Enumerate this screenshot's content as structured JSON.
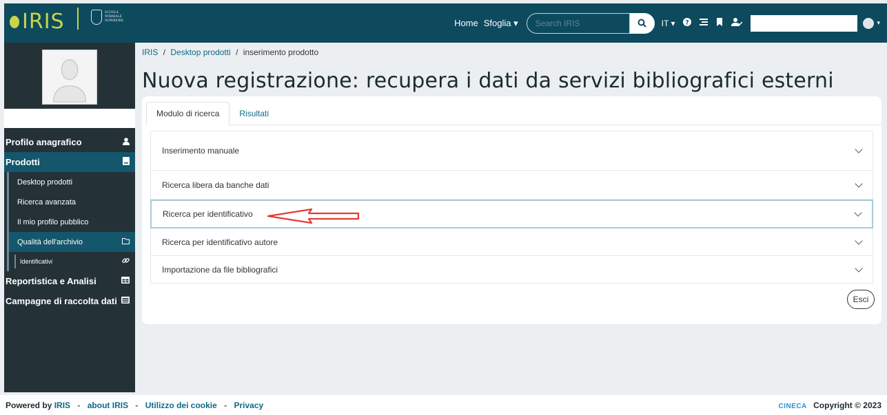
{
  "header": {
    "logo_text": "IRIS",
    "institution_text": "SCUOLA NORMALE SUPERIORE",
    "nav": {
      "home": "Home",
      "browse": "Sfoglia ▾"
    },
    "search": {
      "placeholder": "Search IRIS"
    },
    "language": "IT ▾",
    "icons": [
      "help-icon",
      "list-icon",
      "bookmark-icon",
      "user-badge-icon",
      "user-avatar-icon"
    ]
  },
  "sidebar": {
    "items": [
      {
        "label": "Profilo anagrafico",
        "icon": "user-icon"
      },
      {
        "label": "Prodotti",
        "icon": "book-icon"
      },
      {
        "label": "Desktop prodotti"
      },
      {
        "label": "Ricerca avanzata"
      },
      {
        "label": "Il mio profilo pubblico"
      },
      {
        "label": "Qualità dell'archivio",
        "icon": "folder-icon"
      },
      {
        "label": "Identificativi",
        "icon": "link-icon"
      },
      {
        "label": "Reportistica e Analisi",
        "icon": "table-icon"
      },
      {
        "label": "Campagne di raccolta dati",
        "icon": "list-icon"
      }
    ]
  },
  "breadcrumb": {
    "home": "IRIS",
    "sep": "/",
    "parent": "Desktop prodotti",
    "current": "inserimento prodotto"
  },
  "page_title": "Nuova registrazione: recupera i dati da servizi bibliografici esterni",
  "tabs": [
    {
      "label": "Modulo di ricerca",
      "active": true
    },
    {
      "label": "Risultati",
      "active": false
    }
  ],
  "accordion": [
    {
      "label": "Inserimento manuale"
    },
    {
      "label": "Ricerca libera da banche dati"
    },
    {
      "label": "Ricerca per identificativo",
      "focused": true
    },
    {
      "label": "Ricerca per identificativo autore"
    },
    {
      "label": "Importazione da file bibliografici"
    }
  ],
  "exit_button": "Esci",
  "footer": {
    "powered_by": "Powered by",
    "iris": "IRIS",
    "about": "about IRIS",
    "cookies": "Utilizzo dei cookie",
    "privacy": "Privacy",
    "sep": "-",
    "cineca": "CINECA",
    "copyright": "Copyright © 2023"
  },
  "colors": {
    "navbar": "#0d4a5e",
    "sidebar": "#243238",
    "accent": "#0d6a86",
    "arrow": "#e53935"
  }
}
